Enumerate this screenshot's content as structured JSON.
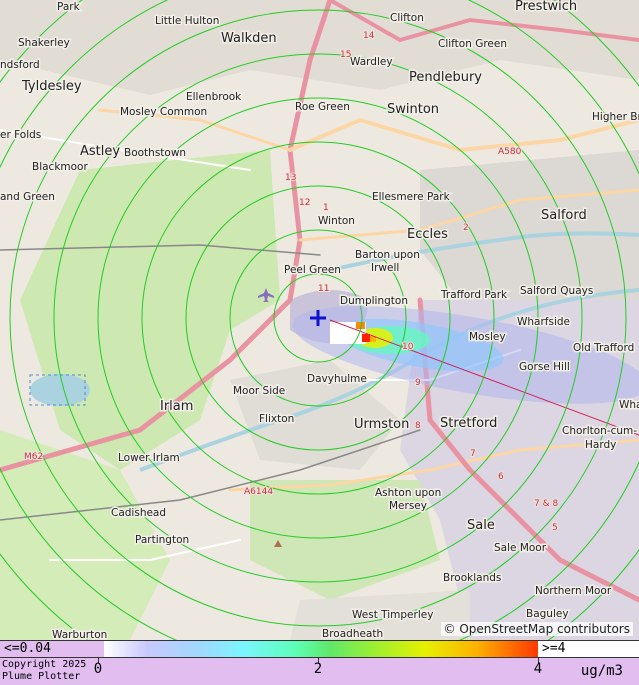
{
  "map": {
    "attribution": "© OpenStreetMap contributors",
    "places_town": [
      {
        "name": "Walkden"
      },
      {
        "name": "Tyldesley"
      },
      {
        "name": "Pendlebury"
      },
      {
        "name": "Swinton"
      },
      {
        "name": "Astley"
      },
      {
        "name": "Eccles"
      },
      {
        "name": "Salford"
      },
      {
        "name": "Irlam"
      },
      {
        "name": "Urmston"
      },
      {
        "name": "Stretford"
      },
      {
        "name": "Sale"
      },
      {
        "name": "Prestwich"
      }
    ],
    "places_village": [
      {
        "name": "Little Hulton"
      },
      {
        "name": "Shakerley"
      },
      {
        "name": "Clifton"
      },
      {
        "name": "Clifton Green"
      },
      {
        "name": "Wardley"
      },
      {
        "name": "Ellenbrook"
      },
      {
        "name": "Mosley Common"
      },
      {
        "name": "Roe Green"
      },
      {
        "name": "Higher Bro"
      },
      {
        "name": "Boothstown"
      },
      {
        "name": "Blackmoor"
      },
      {
        "name": "er Folds"
      },
      {
        "name": "Ellesmere Park"
      },
      {
        "name": "Winton"
      },
      {
        "name": "and Green"
      },
      {
        "name": "Barton upon"
      },
      {
        "name": "Irwell"
      },
      {
        "name": "Peel Green"
      },
      {
        "name": "Trafford Park"
      },
      {
        "name": "Salford Quays"
      },
      {
        "name": "Dumplington"
      },
      {
        "name": "Wharfside"
      },
      {
        "name": "Mosley"
      },
      {
        "name": "Old Trafford"
      },
      {
        "name": "Gorse Hill"
      },
      {
        "name": "Moor Side"
      },
      {
        "name": "Davyhulme"
      },
      {
        "name": "Flixton"
      },
      {
        "name": "Chorlton-cum-"
      },
      {
        "name": "Hardy"
      },
      {
        "name": "Lower Irlam"
      },
      {
        "name": "Ashton upon"
      },
      {
        "name": "Mersey"
      },
      {
        "name": "Cadishead"
      },
      {
        "name": "Partington"
      },
      {
        "name": "Sale Moor"
      },
      {
        "name": "Brooklands"
      },
      {
        "name": "Northern Moor"
      },
      {
        "name": "West Timperley"
      },
      {
        "name": "Baguley"
      },
      {
        "name": "Broadheath"
      },
      {
        "name": "Warburton"
      },
      {
        "name": "Wha"
      },
      {
        "name": "Park"
      },
      {
        "name": "ndsford"
      }
    ],
    "road_labels": [
      "A580",
      "M62",
      "A6144",
      "12",
      "13",
      "15",
      "14",
      "11",
      "10",
      "9",
      "8",
      "7",
      "6",
      "7 & 8",
      "1",
      "2",
      "5"
    ],
    "source_marker": "source-cross"
  },
  "legend": {
    "low_label": "<=0.04",
    "high_label": ">=4",
    "ticks": [
      "0",
      "2",
      "4"
    ],
    "units": "ug/m3",
    "copyright_line1": "Copyright 2025",
    "copyright_line2": "Plume Plotter"
  },
  "colors": {
    "ring": "#22cc22",
    "plume_core": "#ff2000",
    "plume_edge": "#7aa0ff"
  }
}
